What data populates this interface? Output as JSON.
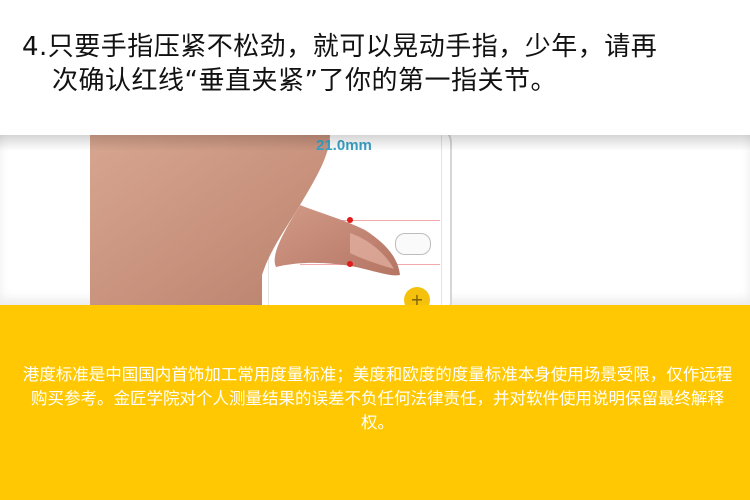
{
  "instruction": {
    "line1": "4.只要手指压紧不松劲，就可以晃动手指，少年，请再",
    "line2": "次确认红线“垂直夹紧”了你的第一指关节。"
  },
  "photo": {
    "measure_value": "21.0mm",
    "add_button_label": "+"
  },
  "disclaimer": {
    "text": "港度标准是中国国内首饰加工常用度量标准；美度和欧度的度量标准本身使用场景受限，仅作远程购买参考。金匠学院对个人测量结果的误差不负任何法律责任，并对软件使用说明保留最终解释权。"
  },
  "colors": {
    "banner_background": "#ffc802",
    "measure_text": "#3aa2c7",
    "marker_red": "#e21b1b",
    "add_button": "#f4c20d"
  }
}
